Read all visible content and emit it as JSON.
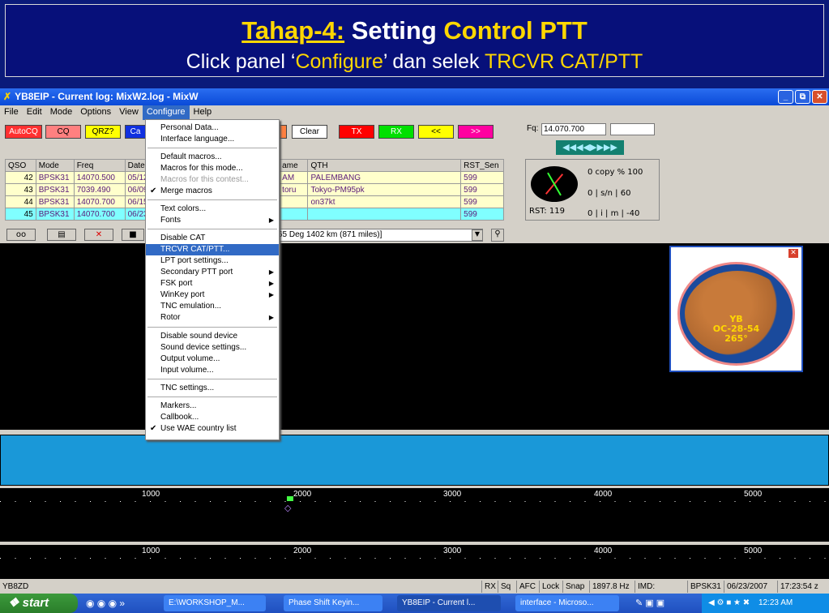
{
  "slide": {
    "title_part1": "Tahap-4:",
    "title_part2": "Setting",
    "title_part3": "Control PTT",
    "subtitle_part1": "Click panel ‘",
    "subtitle_part2": "Configure",
    "subtitle_part3": "’ dan selek",
    "subtitle_part4": "TRCVR CAT/PTT"
  },
  "window": {
    "title": "YB8EIP - Current log: MixW2.log - MixW",
    "menu": [
      "File",
      "Edit",
      "Mode",
      "Options",
      "View",
      "Configure",
      "Help"
    ]
  },
  "toolbar": {
    "autocq": "AutoCQ",
    "cq": "CQ",
    "qrz": "QRZ?",
    "ca": "Ca",
    "clear": "Clear",
    "tx": "TX",
    "rx": "RX",
    "back": "<<",
    "fwd": ">>"
  },
  "freq": {
    "label": "Fq:",
    "value": "14.070.700",
    "tune": "◀◀◀◀▶▶▶▶"
  },
  "log": {
    "headers": [
      "QSO",
      "Mode",
      "Freq",
      "Date",
      "ame",
      "QTH",
      "RST_Sen"
    ],
    "rows": [
      [
        "42",
        "BPSK31",
        "14070.500",
        "05/12",
        "AM",
        "PALEMBANG",
        "599"
      ],
      [
        "43",
        "BPSK31",
        "7039.490",
        "06/09",
        "toru",
        "Tokyo-PM95pk",
        "599"
      ],
      [
        "44",
        "BPSK31",
        "14070.700",
        "06/15",
        "",
        "on37kt",
        "599"
      ],
      [
        "45",
        "BPSK31",
        "14070.700",
        "06/23",
        "",
        "",
        "599"
      ]
    ]
  },
  "info_line": "65 Deg  1402 km (871 miles)]",
  "meter": {
    "copy": "0  copy %   100",
    "sn": "0   | s/n  |   60",
    "imd": "0   | i  | m  |  -40",
    "rst": "RST: 119"
  },
  "configure_menu": [
    "Personal Data...",
    "Interface language...",
    "Default macros...",
    "Macros for this mode...",
    "Macros for this contest...",
    "Merge macros",
    "Text colors...",
    "Fonts",
    "Disable CAT",
    "TRCVR CAT/PTT...",
    "LPT port settings...",
    "Secondary PTT port",
    "FSK port",
    "WinKey port",
    "TNC emulation...",
    "Rotor",
    "Disable sound device",
    "Sound device settings...",
    "Output volume...",
    "Input volume...",
    "TNC settings...",
    "Markers...",
    "Callbook...",
    "Use WAE country list"
  ],
  "globe": {
    "call": "YB",
    "zone": "OC-28-54",
    "bearing": "265°"
  },
  "waterfall_ticks": [
    "1000",
    "2000",
    "3000",
    "4000",
    "5000"
  ],
  "status": [
    "YB8ZD",
    "RX",
    "Sq",
    "AFC",
    "Lock",
    "Snap",
    "1897.8 Hz",
    "IMD:",
    "BPSK31",
    "06/23/2007",
    "17:23:54 z"
  ],
  "taskbar": {
    "start": "start",
    "tasks": [
      "E:\\WORKSHOP_M...",
      "Phase Shift Keyin...",
      "YB8EIP - Current l...",
      "interface - Microso..."
    ],
    "clock": "12:23 AM"
  }
}
